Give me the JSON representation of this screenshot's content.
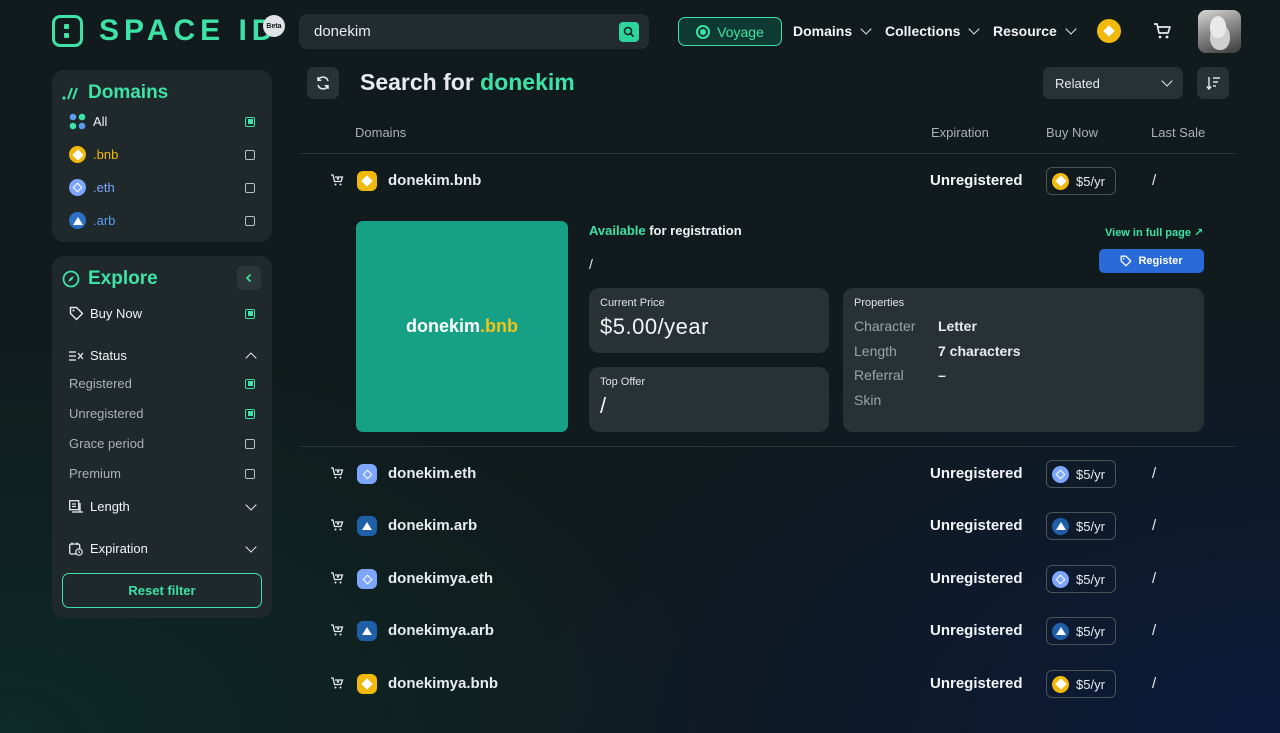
{
  "header": {
    "logo_text": "SPACE ID",
    "beta_badge": "Beta",
    "search_value": "donekim",
    "voyage_label": "Voyage",
    "nav": [
      {
        "label": "Domains"
      },
      {
        "label": "Collections"
      },
      {
        "label": "Resource"
      }
    ]
  },
  "sidebar": {
    "domains_title": "Domains",
    "domain_filters": [
      {
        "label": "All",
        "checked": true
      },
      {
        "label": ".bnb",
        "checked": false,
        "color": "#f0b90b"
      },
      {
        "label": ".eth",
        "checked": false,
        "color": "#7ea6ff"
      },
      {
        "label": ".arb",
        "checked": false,
        "color": "#5b9cf0"
      }
    ],
    "explore_title": "Explore",
    "buy_now_label": "Buy Now",
    "status_label": "Status",
    "status_options": [
      {
        "label": "Registered",
        "checked": true
      },
      {
        "label": "Unregistered",
        "checked": true
      },
      {
        "label": "Grace period",
        "checked": false
      },
      {
        "label": "Premium",
        "checked": false
      }
    ],
    "length_label": "Length",
    "expiration_label": "Expiration",
    "reset_label": "Reset filter"
  },
  "main": {
    "title_prefix": "Search for",
    "title_keyword": "donekim",
    "sort_value": "Related",
    "columns": {
      "domains": "Domains",
      "expiration": "Expiration",
      "buy_now": "Buy Now",
      "last_sale": "Last Sale"
    },
    "rows": [
      {
        "name": "donekim.bnb",
        "tld": "bnb",
        "status": "Unregistered",
        "price": "$5/yr",
        "last_sale": "/"
      },
      {
        "name": "donekim.eth",
        "tld": "eth",
        "status": "Unregistered",
        "price": "$5/yr",
        "last_sale": "/"
      },
      {
        "name": "donekim.arb",
        "tld": "arb",
        "status": "Unregistered",
        "price": "$5/yr",
        "last_sale": "/"
      },
      {
        "name": "donekimya.eth",
        "tld": "eth",
        "status": "Unregistered",
        "price": "$5/yr",
        "last_sale": "/"
      },
      {
        "name": "donekimya.arb",
        "tld": "arb",
        "status": "Unregistered",
        "price": "$5/yr",
        "last_sale": "/"
      },
      {
        "name": "donekimya.bnb",
        "tld": "bnb",
        "status": "Unregistered",
        "price": "$5/yr",
        "last_sale": "/"
      }
    ],
    "detail": {
      "preview_name": "donekim",
      "preview_tld": ".bnb",
      "available_word": "Available",
      "available_rest": " for registration",
      "owner_line": "/",
      "view_full": "View in full page ↗",
      "register_label": "Register",
      "current_price_label": "Current Price",
      "current_price_value": "$5.00/year",
      "top_offer_label": "Top Offer",
      "top_offer_value": "/",
      "properties_label": "Properties",
      "properties": [
        {
          "key": "Character",
          "value": "Letter"
        },
        {
          "key": "Length",
          "value": "7 characters"
        },
        {
          "key": "Referral",
          "value": "–"
        },
        {
          "key": "Skin",
          "value": ""
        }
      ]
    }
  },
  "colors": {
    "accent": "#3ee2a6",
    "bnb": "#f0b90b",
    "eth": "#7ea6ff",
    "arb": "#1e5fa8",
    "register": "#2a6ad8",
    "preview_bg": "#16a085"
  }
}
